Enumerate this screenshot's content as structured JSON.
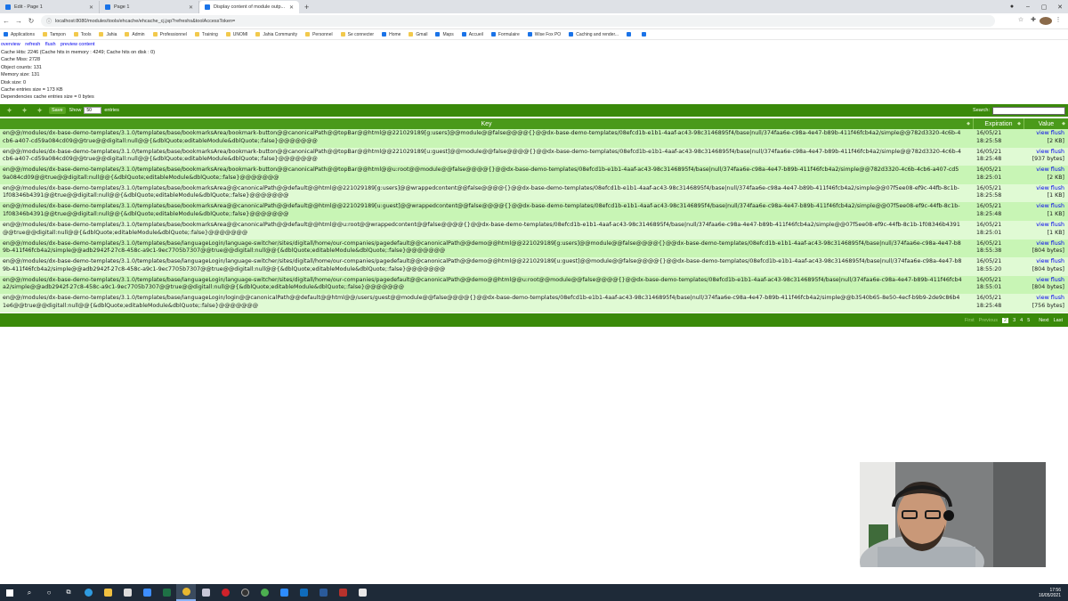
{
  "browser": {
    "tabs": [
      {
        "title": "Edit - Page 1"
      },
      {
        "title": "Page 1"
      },
      {
        "title": "Display content of module outp..."
      }
    ],
    "url": "localhost:8080/modules/tools/ehcache/ehcache_cj.jsp?refreshs&toolAccessToken=",
    "bookmarks": [
      "Applications",
      "Tampon",
      "Tools",
      "Jahia",
      "Admin",
      "Professionnel",
      "Training",
      "UNOMI",
      "Jahia Community",
      "Personnel",
      "Se connecter",
      "Home",
      "Gmail",
      "Maps",
      "Accueil",
      "Formulaire",
      "Wise Fox PO",
      "Caching and render..."
    ]
  },
  "page": {
    "links": [
      "overview",
      "refresh",
      "flush",
      "preview content"
    ],
    "stats": [
      "Cache Hits: 2246 (Cache hits in memory : 4249; Cache hits on disk : 0)",
      "Cache Miss: 2728",
      "Object counts: 131",
      "Memory size: 131",
      "Disk size: 0",
      "Cache entries size = 173 KB",
      "Dependencies cache entries size = 0 bytes"
    ]
  },
  "table": {
    "save_label": "Save",
    "show_label": "Show",
    "page_size": "50",
    "entries_label": "entries",
    "search_label": "Search:",
    "columns": [
      "Key",
      "Expiration",
      "Value"
    ],
    "rows": [
      {
        "key": "en@@/modules/dx-base-demo-templates/3.1.0/templates/base/bookmarksArea/bookmark-button@@canonicalPath@@topBar@@html@@221029189[g:users]@@module@@false@@@@{}@@dx-base-demo-templates/08efcd1b-e1b1-4aaf-ac43-98c3146895f4/base|null/374faa6e-c98a-4e47-b89b-411f46fcb4a2/simple@@782d3320-4c6b-4cb6-a407-cd59a084cd09@@true@@digitall:null@@{&dblQuote;editableModule&dblQuote;:false}@@@@@@@",
        "expiration": "16/05/21 18:25:58",
        "view": "view",
        "flush": "flush",
        "size": "[2 KB]"
      },
      {
        "key": "en@@/modules/dx-base-demo-templates/3.1.0/templates/base/bookmarksArea/bookmark-button@@canonicalPath@@topBar@@html@@221029189[u:guest]@@module@@false@@@@{}@@dx-base-demo-templates/08efcd1b-e1b1-4aaf-ac43-98c3146895f4/base|null/374faa6e-c98a-4e47-b89b-411f46fcb4a2/simple@@782d3320-4c6b-4cb6-a407-cd59a084cd09@@true@@digitall:null@@{&dblQuote;editableModule&dblQuote;:false}@@@@@@@",
        "expiration": "16/05/21 18:25:48",
        "view": "view",
        "flush": "flush",
        "size": "[937 bytes]"
      },
      {
        "key": "en@@/modules/dx-base-demo-templates/3.1.0/templates/base/bookmarksArea/bookmark-button@@canonicalPath@@topBar@@html@@u:root@@module@@false@@@@{}@@dx-base-demo-templates/08efcd1b-e1b1-4aaf-ac43-98c3146895f4/base|null/374faa6e-c98a-4e47-b89b-411f46fcb4a2/simple@@782d3320-4c6b-4cb6-a407-cd59a084cd09@@true@@digitall:null@@{&dblQuote;editableModule&dblQuote;:false}@@@@@@@",
        "expiration": "16/05/21 18:25:01",
        "view": "view",
        "flush": "flush",
        "size": "[2 KB]"
      },
      {
        "key": "en@@/modules/dx-base-demo-templates/3.1.0/templates/base/bookmarksArea@@canonicalPath@@default@@html@@221029189[g:users]@@wrappedcontent@@false@@@@{}@@dx-base-demo-templates/08efcd1b-e1b1-4aaf-ac43-98c3146895f4/base|null/374faa6e-c98a-4e47-b89b-411f46fcb4a2/simple@@07f5ee08-ef9c-44fb-8c1b-1f08346b4391@@true@@digitall:null@@{&dblQuote;editableModule&dblQuote;:false}@@@@@@@",
        "expiration": "16/05/21 18:25:58",
        "view": "view",
        "flush": "flush",
        "size": "[1 KB]"
      },
      {
        "key": "en@@/modules/dx-base-demo-templates/3.1.0/templates/base/bookmarksArea@@canonicalPath@@default@@html@@221029189[u:guest]@@wrappedcontent@@false@@@@{}@@dx-base-demo-templates/08efcd1b-e1b1-4aaf-ac43-98c3146895f4/base|null/374faa6e-c98a-4e47-b89b-411f46fcb4a2/simple@@07f5ee08-ef9c-44fb-8c1b-1f08346b4391@@true@@digitall:null@@{&dblQuote;editableModule&dblQuote;:false}@@@@@@@",
        "expiration": "16/05/21 18:25:48",
        "view": "view",
        "flush": "flush",
        "size": "[1 KB]"
      },
      {
        "key": "en@@/modules/dx-base-demo-templates/3.1.0/templates/base/bookmarksArea@@canonicalPath@@default@@html@@u:root@@wrappedcontent@@false@@@@{}@@dx-base-demo-templates/08efcd1b-e1b1-4aaf-ac43-98c3146895f4/base|null/374faa6e-c98a-4e47-b89b-411f46fcb4a2/simple@@07f5ee08-ef9c-44fb-8c1b-1f08346b4391@@true@@digitall:null@@{&dblQuote;editableModule&dblQuote;:false}@@@@@@@",
        "expiration": "16/05/21 18:25:01",
        "view": "view",
        "flush": "flush",
        "size": "[1 KB]"
      },
      {
        "key": "en@@/modules/dx-base-demo-templates/3.1.0/templates/base/languageLogin/language-switcher/sites/digitall/home/our-companies/pagedefault@@canonicalPath@@demo@@html@@221029189[g:users]@@module@@false@@@@{}@@dx-base-demo-templates/08efcd1b-e1b1-4aaf-ac43-98c3146895f4/base|null/374faa6e-c98a-4e47-b89b-411f46fcb4a2/simple@@adb2942f-27c8-458c-a9c1-9ec7705b7307@@true@@digitall:null@@{&dblQuote;editableModule&dblQuote;:false}@@@@@@@",
        "expiration": "16/05/21 18:55:38",
        "view": "view",
        "flush": "flush",
        "size": "[804 bytes]"
      },
      {
        "key": "en@@/modules/dx-base-demo-templates/3.1.0/templates/base/languageLogin/language-switcher/sites/digitall/home/our-companies/pagedefault@@canonicalPath@@demo@@html@@221029189[u:guest]@@module@@false@@@@{}@@dx-base-demo-templates/08efcd1b-e1b1-4aaf-ac43-98c3146895f4/base|null/374faa6e-c98a-4e47-b89b-411f46fcb4a2/simple@@adb2942f-27c8-458c-a9c1-9ec7705b7307@@true@@digitall:null@@{&dblQuote;editableModule&dblQuote;:false}@@@@@@@",
        "expiration": "16/05/21 18:55:20",
        "view": "view",
        "flush": "flush",
        "size": "[804 bytes]"
      },
      {
        "key": "en@@/modules/dx-base-demo-templates/3.1.0/templates/base/languageLogin/language-switcher/sites/digitall/home/our-companies/pagedefault@@canonicalPath@@demo@@html@@u:root@@module@@false@@@@{}@@dx-base-demo-templates/08efcd1b-e1b1-4aaf-ac43-98c3146895f4/base|null/374faa6e-c98a-4e47-b89b-411f46fcb4a2/simple@@adb2942f-27c8-458c-a9c1-9ec7705b7307@@true@@digitall:null@@{&dblQuote;editableModule&dblQuote;:false}@@@@@@@",
        "expiration": "16/05/21 18:55:01",
        "view": "view",
        "flush": "flush",
        "size": "[804 bytes]"
      },
      {
        "key": "en@@/modules/dx-base-demo-templates/3.1.0/templates/base/languageLogin/login@@canonicalPath@@default@@html@@/users/guest@@module@@false@@@@{}@@dx-base-demo-templates/08efcd1b-e1b1-4aaf-ac43-98c3146895f4/base|null/374faa6e-c98a-4e47-b89b-411f46fcb4a2/simple@@b3540b65-8e50-4ecf-b9b9-2de9c86b41e6@@true@@digitall:null@@{&dblQuote;editableModule&dblQuote;:false}@@@@@@@",
        "expiration": "16/05/21 18:25:48",
        "view": "view",
        "flush": "flush",
        "size": "[756 bytes]"
      }
    ],
    "pager": {
      "first": "First",
      "previous": "Previous",
      "pages": [
        "2",
        "3",
        "4",
        "5"
      ],
      "next": "Next",
      "last": "Last"
    }
  },
  "taskbar": {
    "time": "17:56",
    "date": "16/05/2021"
  },
  "colors": {
    "table_green": "#3a8a0a",
    "row_odd": "#c8f5b5",
    "row_even": "#e0fad4",
    "link_blue": "#0000ee"
  }
}
